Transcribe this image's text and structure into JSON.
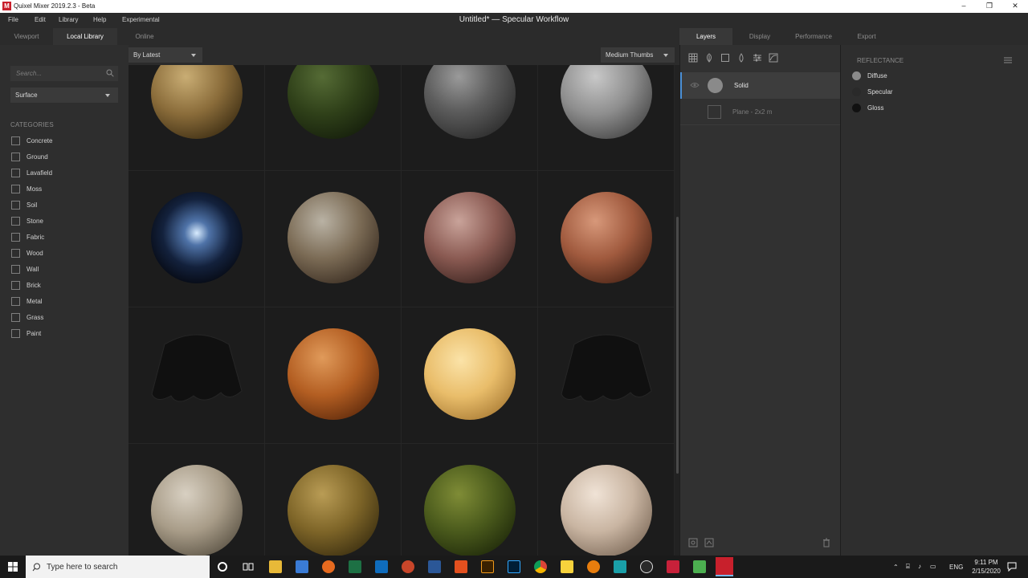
{
  "window": {
    "app_title": "Quixel Mixer 2019.2.3 - Beta",
    "document_title": "Untitled* — Specular Workflow",
    "app_icon_glyph": "M",
    "minimize_glyph": "–",
    "maximize_glyph": "❐",
    "close_glyph": "✕"
  },
  "menu": [
    "File",
    "Edit",
    "Library",
    "Help",
    "Experimental"
  ],
  "left_tabs": [
    "Viewport",
    "Local Library",
    "Online"
  ],
  "left_tabs_active": "Local Library",
  "sidebar": {
    "search_placeholder": "Search...",
    "type_dropdown": "Surface",
    "categories_heading": "CATEGORIES",
    "categories": [
      "Concrete",
      "Ground",
      "Lavafield",
      "Moss",
      "Soil",
      "Stone",
      "Fabric",
      "Wood",
      "Wall",
      "Brick",
      "Metal",
      "Grass",
      "Paint"
    ]
  },
  "grid": {
    "sort_dropdown": "By Latest",
    "size_dropdown": "Medium Thumbs"
  },
  "right_tabs": [
    "Layers",
    "Display",
    "Performance",
    "Export"
  ],
  "right_tabs_active": "Layers",
  "layers": [
    {
      "name": "Solid",
      "selected": true
    },
    {
      "name": "Plane - 2x2 m",
      "selected": false
    }
  ],
  "properties": {
    "heading": "REFLECTANCE",
    "items": [
      {
        "label": "Diffuse",
        "color": "#8a8a8a"
      },
      {
        "label": "Specular",
        "color": "#2a2a2a"
      },
      {
        "label": "Gloss",
        "color": "#111111"
      }
    ]
  },
  "taskbar": {
    "search_text": "Type here to search",
    "language": "ENG",
    "time": "9:11 PM",
    "date": "2/15/2020"
  }
}
